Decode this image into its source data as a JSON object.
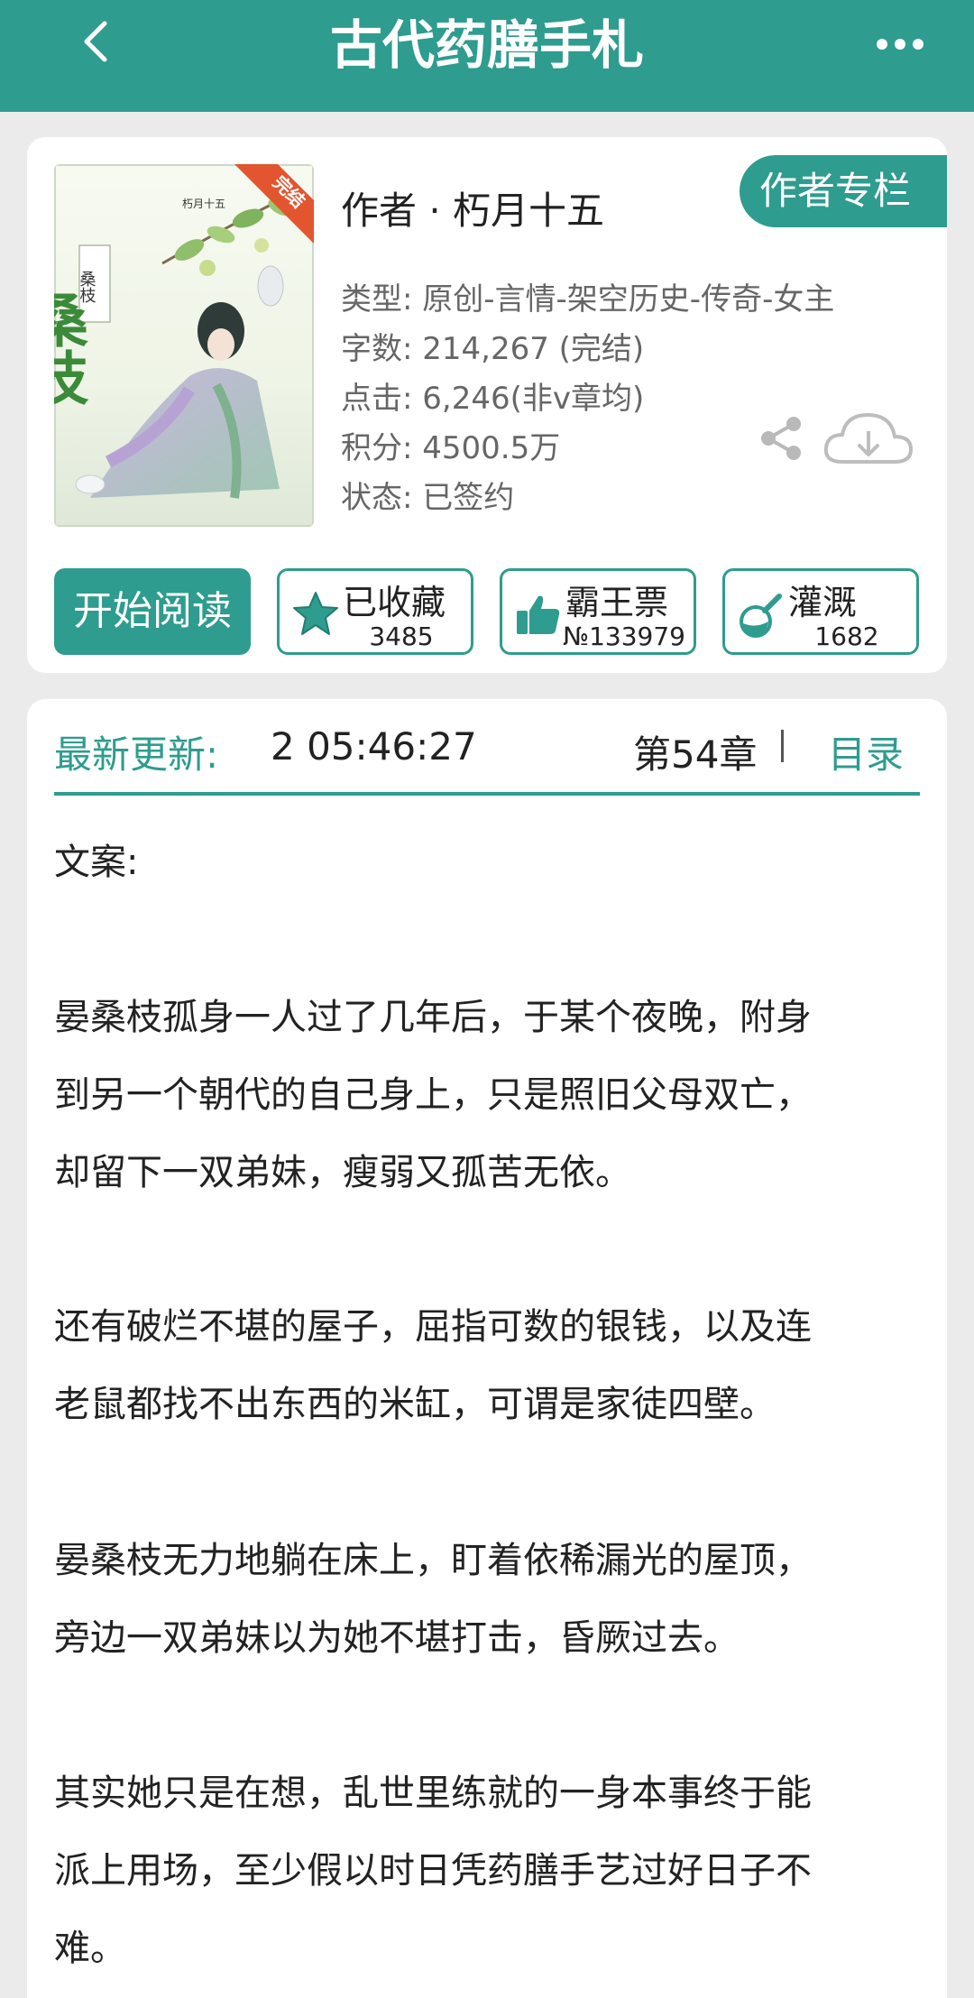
{
  "header": {
    "title": "古代药膳手札"
  },
  "book": {
    "cover": {
      "badge": "完结",
      "author_mark": "朽月十五",
      "title_big": "桑枝",
      "title_small": "桑枝"
    },
    "author_label": "作者 · 朽月十五",
    "author_column_label": "作者专栏",
    "info": {
      "genre": "类型: 原创-言情-架空历史-传奇-女主",
      "words": "字数: 214,267 (完结)",
      "clicks": "点击: 6,246(非v章均)",
      "score": "积分: 4500.5万",
      "status": "状态: 已签约"
    }
  },
  "actions": {
    "read": "开始阅读",
    "collect": {
      "label": "已收藏",
      "count": "3485"
    },
    "ticket": {
      "label": "霸王票",
      "count": "№133979"
    },
    "water": {
      "label": "灌溉",
      "count": "1682"
    }
  },
  "update": {
    "label": "最新更新:",
    "time": "2 05:46:27",
    "chapter": "第54章",
    "toc": "目录"
  },
  "synopsis": {
    "heading": "文案:",
    "paragraphs": [
      [
        "晏桑枝孤身一人过了几年后，于某个夜晚，附身",
        "到另一个朝代的自己身上，只是照旧父母双亡，",
        "却留下一双弟妹，瘦弱又孤苦无依。"
      ],
      [
        "还有破烂不堪的屋子，屈指可数的银钱，以及连",
        "老鼠都找不出东西的米缸，可谓是家徒四壁。"
      ],
      [
        "晏桑枝无力地躺在床上，盯着依稀漏光的屋顶，",
        "旁边一双弟妹以为她不堪打击，昏厥过去。"
      ],
      [
        "其实她只是在想，乱世里练就的一身本事终于能",
        "派上用场，至少假以时日凭药膳手艺过好日子不",
        "难。"
      ]
    ]
  }
}
